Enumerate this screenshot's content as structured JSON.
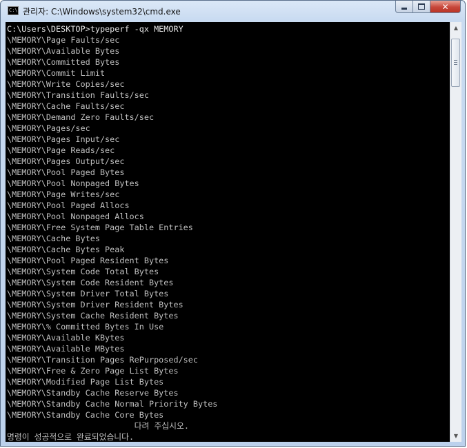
{
  "window": {
    "title": "관리자: C:\\Windows\\system32\\cmd.exe",
    "icon_text": "C:\\",
    "buttons": {
      "minimize": "minimize",
      "maximize": "maximize",
      "close": "✕"
    }
  },
  "console": {
    "lines": [
      "C:\\Users\\DESKTOP>typeperf -qx MEMORY",
      "\\MEMORY\\Page Faults/sec",
      "\\MEMORY\\Available Bytes",
      "\\MEMORY\\Committed Bytes",
      "\\MEMORY\\Commit Limit",
      "\\MEMORY\\Write Copies/sec",
      "\\MEMORY\\Transition Faults/sec",
      "\\MEMORY\\Cache Faults/sec",
      "\\MEMORY\\Demand Zero Faults/sec",
      "\\MEMORY\\Pages/sec",
      "\\MEMORY\\Pages Input/sec",
      "\\MEMORY\\Page Reads/sec",
      "\\MEMORY\\Pages Output/sec",
      "\\MEMORY\\Pool Paged Bytes",
      "\\MEMORY\\Pool Nonpaged Bytes",
      "\\MEMORY\\Page Writes/sec",
      "\\MEMORY\\Pool Paged Allocs",
      "\\MEMORY\\Pool Nonpaged Allocs",
      "\\MEMORY\\Free System Page Table Entries",
      "\\MEMORY\\Cache Bytes",
      "\\MEMORY\\Cache Bytes Peak",
      "\\MEMORY\\Pool Paged Resident Bytes",
      "\\MEMORY\\System Code Total Bytes",
      "\\MEMORY\\System Code Resident Bytes",
      "\\MEMORY\\System Driver Total Bytes",
      "\\MEMORY\\System Driver Resident Bytes",
      "\\MEMORY\\System Cache Resident Bytes",
      "\\MEMORY\\% Committed Bytes In Use",
      "\\MEMORY\\Available KBytes",
      "\\MEMORY\\Available MBytes",
      "\\MEMORY\\Transition Pages RePurposed/sec",
      "\\MEMORY\\Free & Zero Page List Bytes",
      "\\MEMORY\\Modified Page List Bytes",
      "\\MEMORY\\Standby Cache Reserve Bytes",
      "\\MEMORY\\Standby Cache Normal Priority Bytes",
      "\\MEMORY\\Standby Cache Core Bytes",
      "                          다려 주십시오.",
      "명령이 성공적으로 완료되었습니다."
    ]
  },
  "scrollbar": {
    "up_arrow": "▲",
    "down_arrow": "▼",
    "scroll_position": 0.05
  }
}
